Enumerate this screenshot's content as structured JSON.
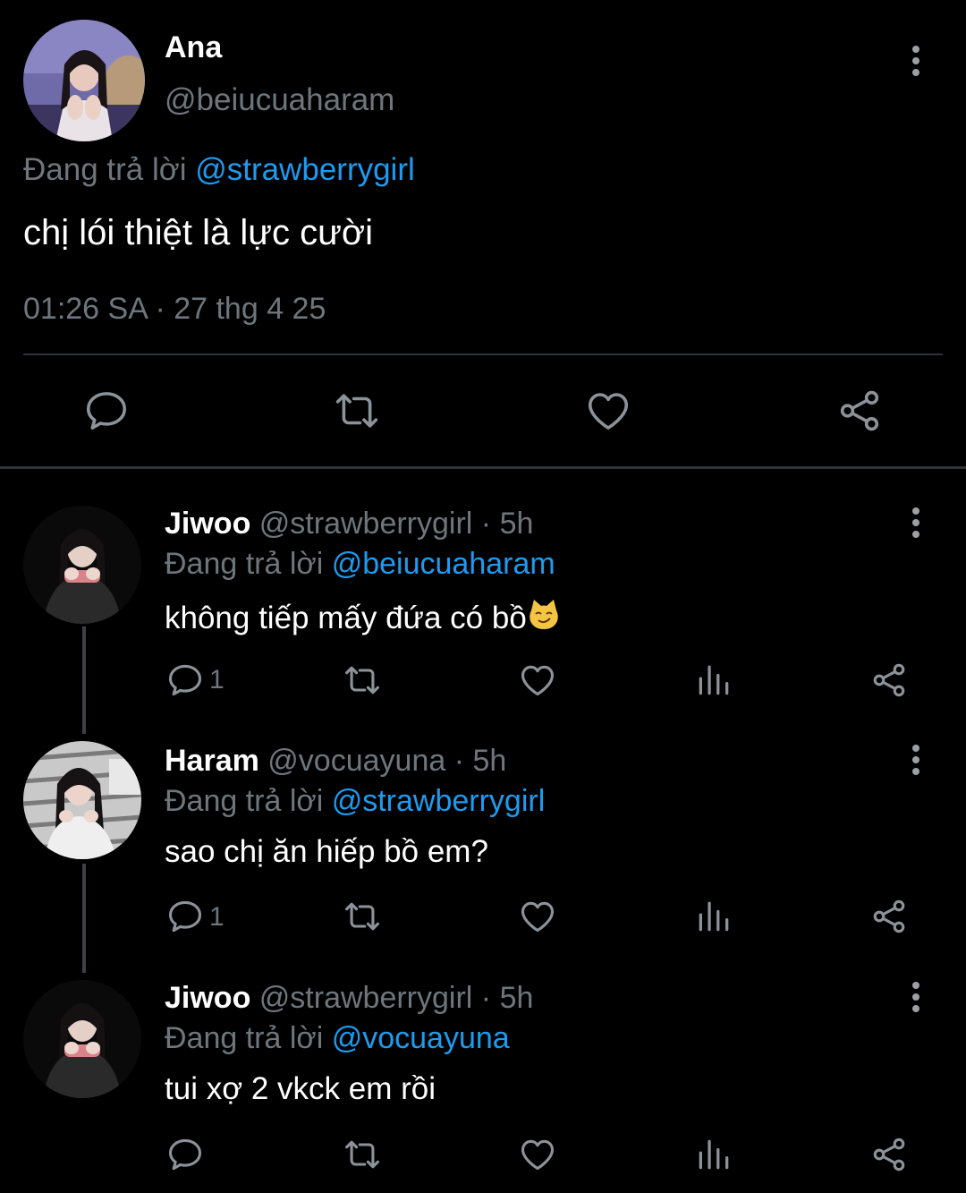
{
  "main_tweet": {
    "display_name": "Ana",
    "handle": "@beiucuaharam",
    "replying_prefix": "Đang trả lời ",
    "replying_to": "@strawberrygirl",
    "text": "chị lói thiệt là lực cười",
    "timestamp": "01:26 SA · 27 thg 4 25",
    "avatar_icon": "profile-photo"
  },
  "replies": [
    {
      "display_name": "Jiwoo",
      "handle": "@strawberrygirl",
      "time": " · 5h",
      "replying_prefix": "Đang trả lời ",
      "replying_to": "@beiucuaharam",
      "text": "không tiếp mấy đứa có bồ",
      "emoji": "smirking-cat-face",
      "reply_count": "1"
    },
    {
      "display_name": "Haram",
      "handle": "@vocuayuna",
      "time": " · 5h",
      "replying_prefix": "Đang trả lời ",
      "replying_to": "@strawberrygirl",
      "text": "sao chị ăn hiếp bồ em?",
      "reply_count": "1"
    },
    {
      "display_name": "Jiwoo",
      "handle": "@strawberrygirl",
      "time": " · 5h",
      "replying_prefix": "Đang trả lời ",
      "replying_to": "@vocuayuna",
      "text": "tui xợ 2 vkck em rồi",
      "reply_count": ""
    }
  ],
  "colors": {
    "background": "#000000",
    "text": "#e7e9ea",
    "muted": "#6e767d",
    "link": "#1d9bf0",
    "divider": "#2f3336"
  }
}
